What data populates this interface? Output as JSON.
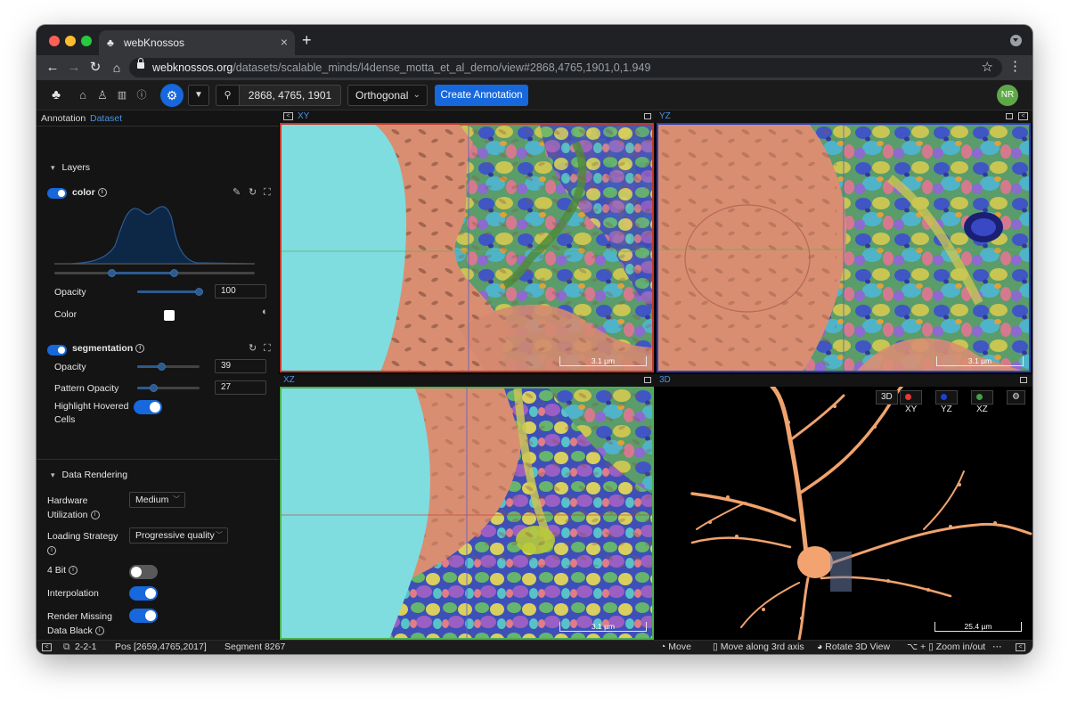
{
  "browser": {
    "tab_title": "webKnossos",
    "url_host": "webknossos.org",
    "url_path": "/datasets/scalable_minds/l4dense_motta_et_al_demo/view#2868,4765,1901,0,1.949"
  },
  "header": {
    "position": "2868, 4765, 1901",
    "view_mode": "Orthogonal",
    "create_annotation_label": "Create Annotation",
    "avatar_initials": "NR"
  },
  "panel": {
    "tabs": [
      "Annotation",
      "Dataset"
    ],
    "active_tab": "Dataset",
    "layers_title": "Layers",
    "color_layer": {
      "name": "color",
      "opacity_label": "Opacity",
      "opacity": "100",
      "color_label": "Color"
    },
    "segmentation_layer": {
      "name": "segmentation",
      "opacity_label": "Opacity",
      "opacity": "39",
      "pattern_opacity_label": "Pattern Opacity",
      "pattern_opacity": "27",
      "highlight_label_1": "Highlight Hovered",
      "highlight_label_2": "Cells"
    },
    "data_rendering": {
      "title": "Data Rendering",
      "hardware_label_1": "Hardware",
      "hardware_label_2": "Utilization",
      "hardware_value": "Medium",
      "loading_label": "Loading Strategy",
      "loading_value": "Progressive quality",
      "four_bit_label": "4 Bit",
      "interpolation_label": "Interpolation",
      "render_missing_label_1": "Render Missing",
      "render_missing_label_2": "Data Black"
    }
  },
  "viewports": {
    "xy": {
      "label": "XY",
      "scale": "3.1 µm"
    },
    "yz": {
      "label": "YZ",
      "scale": "3.1 µm"
    },
    "xz": {
      "label": "XZ",
      "scale": "3.1 µm"
    },
    "td": {
      "label": "3D",
      "scale": "25.4 µm"
    },
    "legend": [
      "3D",
      "XY",
      "YZ",
      "XZ"
    ],
    "legend_colors": [
      "#e53935",
      "#1e3fd6",
      "#43a047"
    ]
  },
  "status": {
    "zoom": "2-2-1",
    "pos": "Pos [2659,4765,2017]",
    "segment": "Segment 8267",
    "move": "Move",
    "move3": "Move along 3rd axis",
    "rotate": "Rotate 3D View",
    "zoom_help": "Zoom in/out"
  },
  "colors": {
    "accent": "#1668dc",
    "xy_border": "#c0392b",
    "yz_border": "#2c3fbf",
    "xz_border": "#4caf50"
  }
}
